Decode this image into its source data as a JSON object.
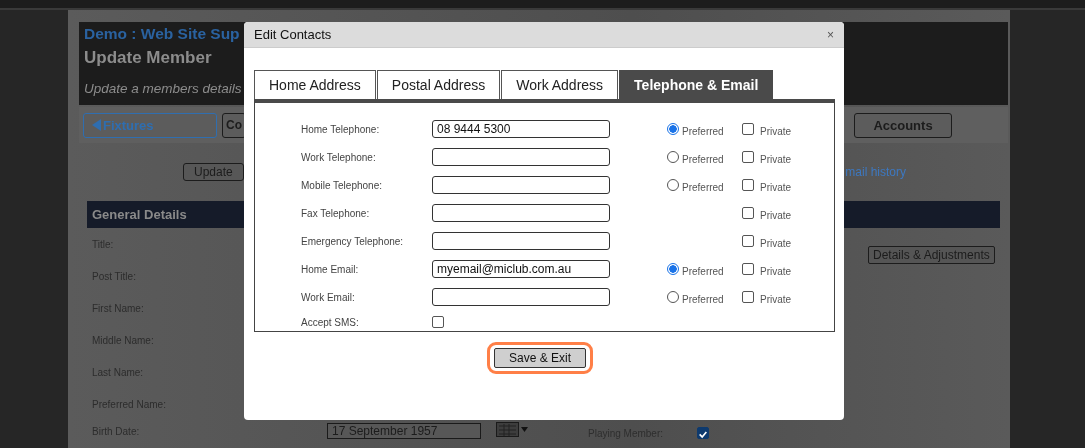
{
  "page": {
    "site_title": "Demo : Web Site Sup",
    "heading": "Update Member",
    "subtitle": "Update a members details",
    "nav_buttons": [
      {
        "label": "Fixtures",
        "kind": "back"
      },
      {
        "label": "Co",
        "kind": "plain"
      },
      {
        "label": "Accounts",
        "kind": "plain"
      }
    ],
    "update_button": "Update",
    "email_history_link": "mail history",
    "section_title": "General Details",
    "fields": [
      "Title:",
      "Post Title:",
      "First Name:",
      "Middle Name:",
      "Last Name:",
      "Preferred Name:",
      "Birth Date:"
    ],
    "birth_date": "17 September 1957",
    "details_button": "Details & Adjustments",
    "playing_member": {
      "label": "Playing Member:",
      "checked": true
    }
  },
  "dialog": {
    "title": "Edit Contacts",
    "close": "×",
    "tabs": [
      {
        "label": "Home Address",
        "selected": false
      },
      {
        "label": "Postal Address",
        "selected": false
      },
      {
        "label": "Work Address",
        "selected": false
      },
      {
        "label": "Telephone & Email",
        "selected": true
      }
    ],
    "rows": [
      {
        "kind": "full",
        "label": "Home Telephone:",
        "value": "08 9444 5300",
        "preferred": true,
        "preferred_label": "Preferred",
        "private": false,
        "private_label": "Private"
      },
      {
        "kind": "full",
        "label": "Work Telephone:",
        "preferred": false,
        "preferred_label": "Preferred",
        "private": false,
        "private_label": "Private"
      },
      {
        "kind": "full",
        "label": "Mobile Telephone:",
        "preferred": false,
        "preferred_label": "Preferred",
        "private": false,
        "private_label": "Private"
      },
      {
        "kind": "private",
        "label": "Fax Telephone:",
        "private": false,
        "private_label": "Private"
      },
      {
        "kind": "private",
        "label": "Emergency Telephone:",
        "private": false,
        "private_label": "Private"
      },
      {
        "kind": "full",
        "label": "Home Email:",
        "value": "myemail@miclub.com.au",
        "preferred": true,
        "preferred_label": "Preferred",
        "private": false,
        "private_label": "Private"
      },
      {
        "kind": "full",
        "label": "Work Email:",
        "preferred": false,
        "preferred_label": "Preferred",
        "private": false,
        "private_label": "Private"
      }
    ],
    "accept_sms": {
      "label": "Accept SMS:",
      "checked": false
    },
    "save_button": "Save & Exit"
  }
}
